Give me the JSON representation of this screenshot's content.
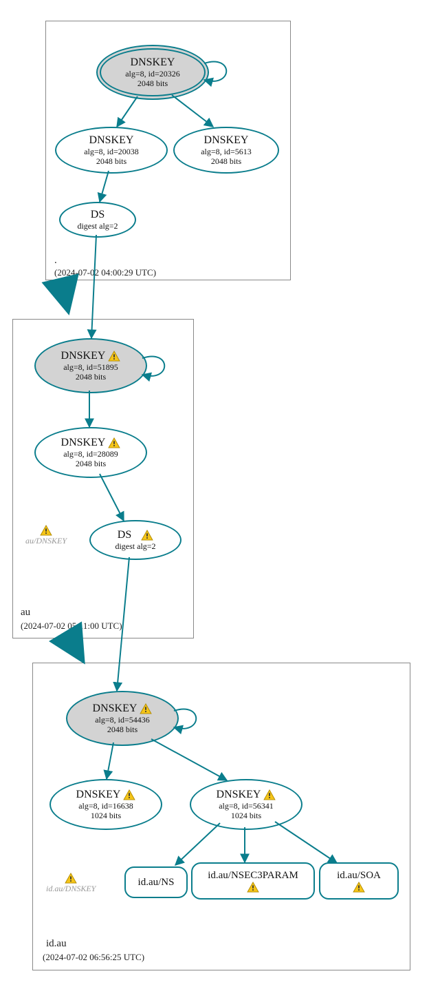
{
  "zones": {
    "root": {
      "name": ".",
      "timestamp": "(2024-07-02 04:00:29 UTC)"
    },
    "au": {
      "name": "au",
      "timestamp": "(2024-07-02 05:11:00 UTC)"
    },
    "idau": {
      "name": "id.au",
      "timestamp": "(2024-07-02 06:56:25 UTC)"
    }
  },
  "nodes": {
    "root_ksk": {
      "title": "DNSKEY",
      "alg": "alg=8, id=20326",
      "bits": "2048 bits"
    },
    "root_zsk1": {
      "title": "DNSKEY",
      "alg": "alg=8, id=20038",
      "bits": "2048 bits"
    },
    "root_zsk2": {
      "title": "DNSKEY",
      "alg": "alg=8, id=5613",
      "bits": "2048 bits"
    },
    "root_ds": {
      "title": "DS",
      "alg": "digest alg=2"
    },
    "au_ksk": {
      "title": "DNSKEY",
      "alg": "alg=8, id=51895",
      "bits": "2048 bits"
    },
    "au_zsk": {
      "title": "DNSKEY",
      "alg": "alg=8, id=28089",
      "bits": "2048 bits"
    },
    "au_ds": {
      "title": "DS",
      "alg": "digest alg=2"
    },
    "idau_ksk": {
      "title": "DNSKEY",
      "alg": "alg=8, id=54436",
      "bits": "2048 bits"
    },
    "idau_zsk1": {
      "title": "DNSKEY",
      "alg": "alg=8, id=16638",
      "bits": "1024 bits"
    },
    "idau_zsk2": {
      "title": "DNSKEY",
      "alg": "alg=8, id=56341",
      "bits": "1024 bits"
    },
    "idau_ns": {
      "title": "id.au/NS"
    },
    "idau_nsec": {
      "title": "id.au/NSEC3PARAM"
    },
    "idau_soa": {
      "title": "id.au/SOA"
    }
  },
  "floats": {
    "au_dnskey": "au/DNSKEY",
    "idau_dnskey": "id.au/DNSKEY"
  }
}
